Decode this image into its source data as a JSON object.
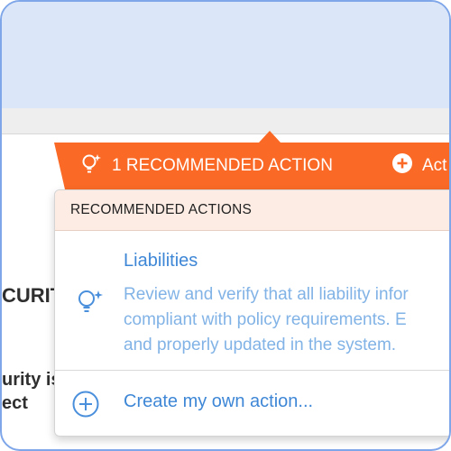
{
  "background": {
    "partial_heading": "CURIT",
    "partial_line1": "urity is",
    "partial_line2": "ect"
  },
  "toolbar": {
    "recommended_label": "1 RECOMMENDED ACTION",
    "add_label": "Act",
    "color": "#fa6a26"
  },
  "panel": {
    "header": "RECOMMENDED ACTIONS",
    "item": {
      "title": "Liabilities",
      "description_lines": [
        "Review and verify that all liability infor",
        "compliant with policy requirements. E",
        "and properly updated in the system."
      ]
    },
    "own_action_label": "Create my own action..."
  },
  "colors": {
    "link": "#3e87d6",
    "muted_link": "#82b3e6",
    "header_bg": "#fdece4"
  },
  "icons": {
    "recommend": "lightbulb-sparkle-icon",
    "add": "plus-circle-icon"
  }
}
